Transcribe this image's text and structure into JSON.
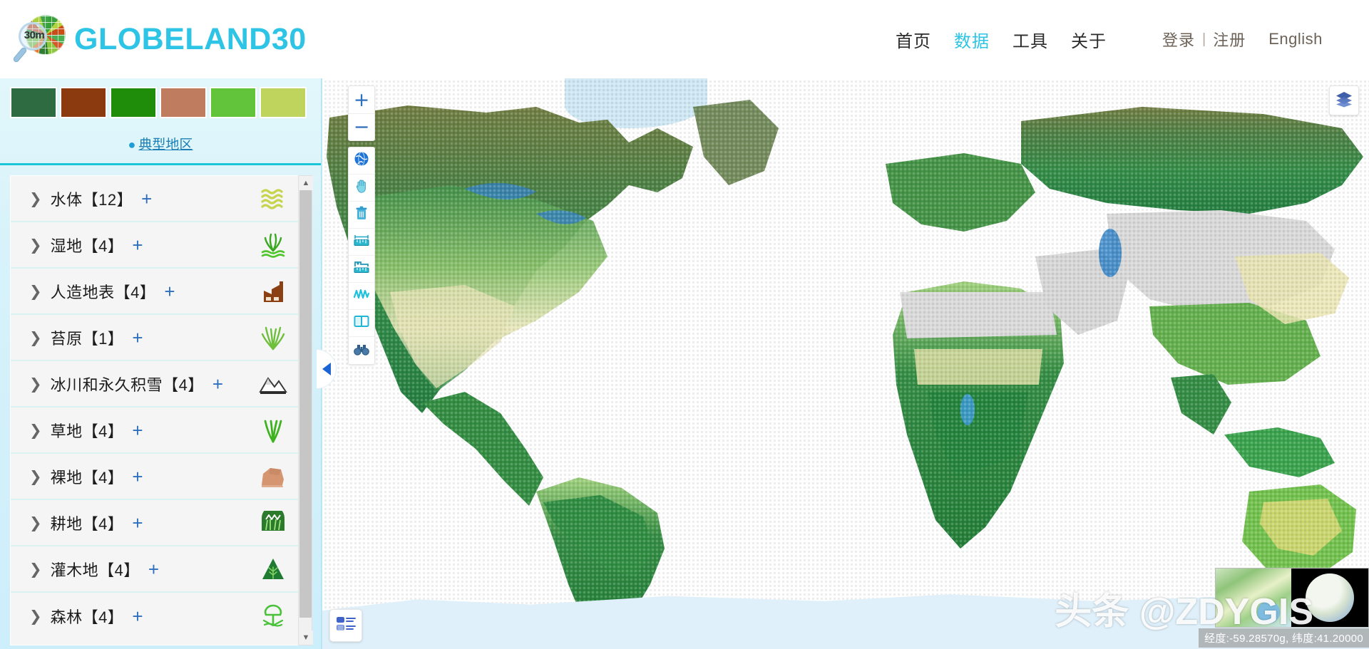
{
  "header": {
    "brand_name": "GLOBELAND30",
    "logo_badge": "30m",
    "brand_color": "#2ec4e6",
    "nav": [
      {
        "label": "首页",
        "active": false
      },
      {
        "label": "数据",
        "active": true
      },
      {
        "label": "工具",
        "active": false
      },
      {
        "label": "关于",
        "active": false
      }
    ],
    "login_label": "登录",
    "separator": "|",
    "register_label": "注册",
    "language_label": "English"
  },
  "sidebar": {
    "swatches": [
      {
        "name": "forest-swatch",
        "color": "#2E6B40"
      },
      {
        "name": "artificial-surface-swatch",
        "color": "#8B3A0F"
      },
      {
        "name": "cultivated-land-swatch",
        "color": "#1F8C0A"
      },
      {
        "name": "bareland-swatch",
        "color": "#BF7C5E"
      },
      {
        "name": "grassland-swatch",
        "color": "#62C43A"
      },
      {
        "name": "shrubland-swatch",
        "color": "#BFD45C"
      }
    ],
    "typical_region": {
      "pin_icon": "location-pin-icon",
      "label": "典型地区"
    },
    "categories": [
      {
        "label": "水体【12】",
        "plus": "+",
        "icon": "water-waves-icon"
      },
      {
        "label": "湿地【4】",
        "plus": "+",
        "icon": "wetland-reeds-icon"
      },
      {
        "label": "人造地表【4】",
        "plus": "+",
        "icon": "factory-building-icon"
      },
      {
        "label": "苔原【1】",
        "plus": "+",
        "icon": "tundra-grass-icon"
      },
      {
        "label": "冰川和永久积雪【4】",
        "plus": "+",
        "icon": "snow-mountain-icon"
      },
      {
        "label": "草地【4】",
        "plus": "+",
        "icon": "grassland-icon"
      },
      {
        "label": "裸地【4】",
        "plus": "+",
        "icon": "bareland-rock-icon"
      },
      {
        "label": "耕地【4】",
        "plus": "+",
        "icon": "cultivated-field-icon"
      },
      {
        "label": "灌木地【4】",
        "plus": "+",
        "icon": "shrub-tree-icon"
      },
      {
        "label": "森林【4】",
        "plus": "+",
        "icon": "forest-tree-icon"
      }
    ],
    "scrollbar": {
      "up_arrow": "▲",
      "down_arrow": "▼"
    },
    "collapse_handle": "collapse-panel-left-icon"
  },
  "map": {
    "zoom_in_label": "+",
    "zoom_out_label": "−",
    "tools": [
      {
        "name": "globe-extent-icon",
        "title": "全图"
      },
      {
        "name": "pan-hand-icon",
        "title": "漫游"
      },
      {
        "name": "clear-trash-icon",
        "title": "清除"
      },
      {
        "name": "measure-distance-icon",
        "title": "测距"
      },
      {
        "name": "measure-area-icon",
        "title": "测面"
      },
      {
        "name": "profile-polyline-icon",
        "title": "剖面"
      },
      {
        "name": "split-compare-icon",
        "title": "卷帘对比"
      },
      {
        "name": "binoculars-search-icon",
        "title": "查询"
      }
    ],
    "layers_icon": "layers-stack-icon",
    "legend_icon": "legend-list-icon",
    "overview_thumb": "overview-map-thumbnail",
    "globe_thumb": "globe-thumbnail",
    "coordinates": "经度:-59.28570g, 纬度:41.20000",
    "watermark": "头条 @ZDYGIS"
  }
}
